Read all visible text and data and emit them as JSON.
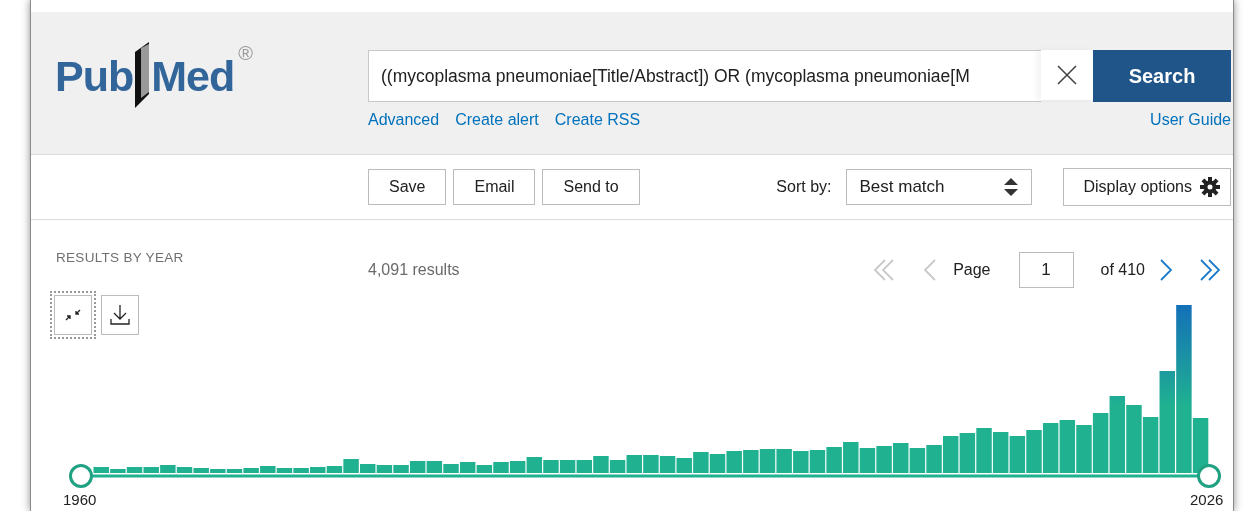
{
  "logo": {
    "first": "Pub",
    "second": "Med",
    "registered": "®"
  },
  "search": {
    "value": "((mycoplasma pneumoniae[Title/Abstract]) OR (mycoplasma pneumoniae[M",
    "button": "Search"
  },
  "links": [
    "Advanced",
    "Create alert",
    "Create RSS"
  ],
  "user_guide": "User Guide",
  "actions": [
    "Save",
    "Email",
    "Send to"
  ],
  "sort": {
    "label": "Sort by:",
    "value": "Best match"
  },
  "display_options": "Display options",
  "timeline": {
    "title": "RESULTS BY YEAR",
    "start": "1960",
    "end": "2026"
  },
  "chart_tools": [
    {
      "kind": "collapse",
      "focused": true
    },
    {
      "kind": "download",
      "focused": false
    }
  ],
  "results": "4,091 results",
  "pagination": {
    "first": {
      "disabled": true
    },
    "previous": {
      "disabled": true
    },
    "label": "Page",
    "page": "1",
    "total": "of 410",
    "next": {
      "disabled": false
    },
    "last": {
      "disabled": false
    }
  }
}
